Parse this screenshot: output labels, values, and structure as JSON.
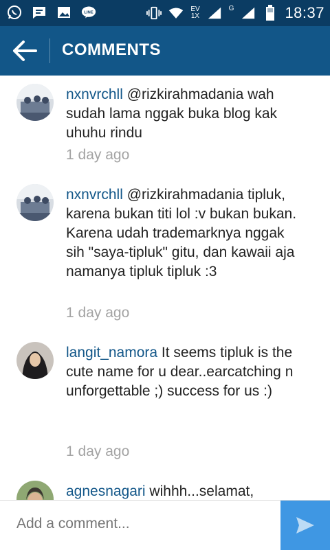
{
  "status_bar": {
    "time": "18:37",
    "network_primary": "EV",
    "network_secondary": "1X",
    "network_g": "G",
    "line_badge": "LINE",
    "icons": [
      "whatsapp-icon",
      "message-icon",
      "gallery-icon",
      "line-icon",
      "vibrate-icon",
      "wifi-icon",
      "signal-icon",
      "battery-icon"
    ]
  },
  "header": {
    "title": "COMMENTS"
  },
  "comments": [
    {
      "username": "nxnvrchll",
      "text": " @rizkirahmadania wah sudah lama nggak buka blog kak uhuhu rindu",
      "time": "1 day ago"
    },
    {
      "username": "nxnvrchll",
      "text": " @rizkirahmadania tipluk, karena bukan titi lol :v bukan bukan. Karena udah trademarknya nggak sih \"saya-tipluk\" gitu, dan kawaii aja namanya tipluk tipluk :3",
      "time": "1 day ago"
    },
    {
      "username": "langit_namora",
      "text": " It seems tipluk is the cute name for u dear..earcatching n unforgettable ;) success for us :)",
      "time": "1 day ago"
    },
    {
      "username": "agnesnagari",
      "text": " wihhh...selamat,",
      "time": ""
    }
  ],
  "footer": {
    "placeholder": "Add a comment..."
  },
  "colors": {
    "status_bar": "#0b3c63",
    "app_bar": "#125688",
    "username": "#125688",
    "timestamp": "#a3a3a3",
    "send_button": "#3f97e3"
  }
}
